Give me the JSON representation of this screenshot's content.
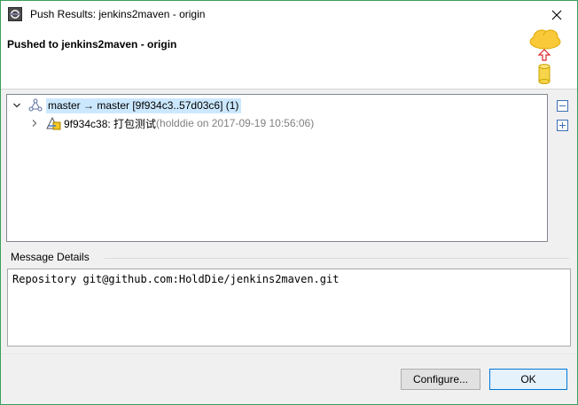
{
  "window": {
    "title": "Push Results: jenkins2maven - origin"
  },
  "banner": {
    "heading": "Pushed to jenkins2maven - origin"
  },
  "tree": {
    "ref_update": {
      "label": "master → master [9f934c3..57d03c6] (1)",
      "expanded": true,
      "icon": "branch-icon"
    },
    "commit": {
      "label": "9f934c38: 打包测试",
      "meta": " (holddie on 2017-09-19 10:56:06)",
      "expanded": false,
      "icon": "commit-icon"
    },
    "collapse_all_icon": "collapse-all-icon",
    "expand_all_icon": "expand-all-icon"
  },
  "message_details": {
    "label": "Message Details",
    "text": "Repository git@github.com:HoldDie/jenkins2maven.git"
  },
  "buttons": {
    "configure": "Configure...",
    "ok": "OK"
  },
  "colors": {
    "selection": "#cce8ff",
    "window_border": "#3aa05a",
    "ok_border": "#0078d7"
  }
}
